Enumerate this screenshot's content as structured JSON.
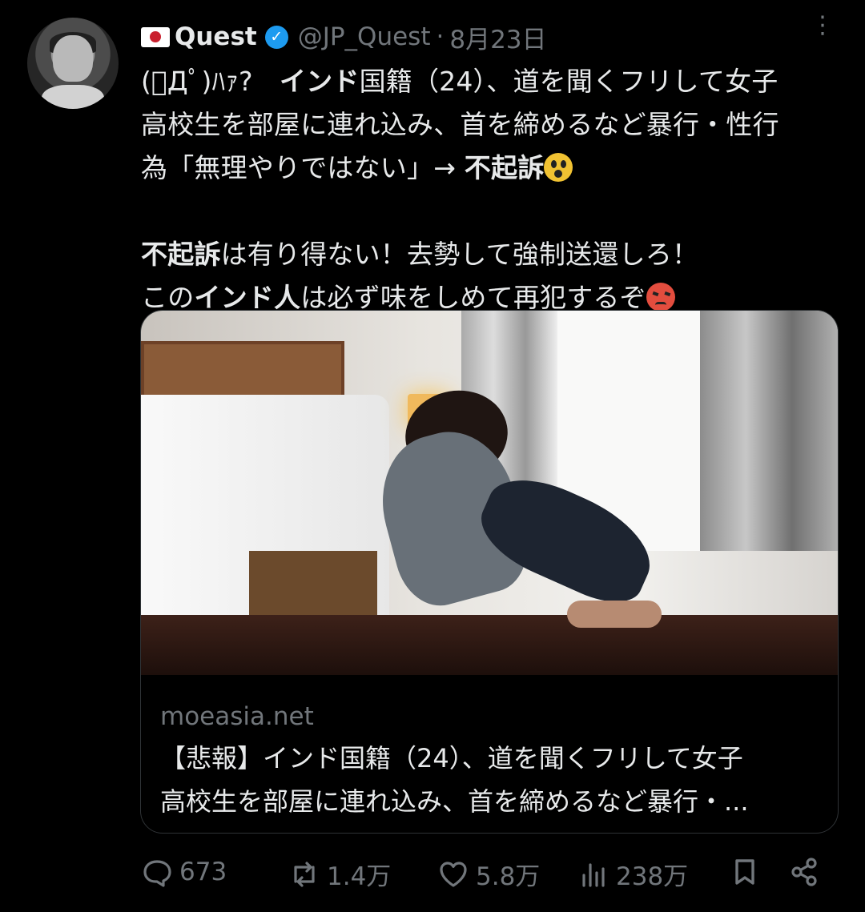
{
  "tweet": {
    "display_name": "Quest",
    "handle": "@JP_Quest",
    "separator": "·",
    "date": "8月23日",
    "more_icon": "three-dots-icon",
    "lines": [
      {
        "parts": [
          "(ﾟДﾟ)ﾊｧ?　",
          "インド",
          "国籍（24）、道を聞くフリして女子"
        ]
      },
      {
        "parts": [
          "高校生を部屋に連れ込み、首を締めるなど暴行・性行"
        ]
      },
      {
        "parts": [
          "為「無理やりではない」→ ",
          "不起訴",
          ""
        ]
      },
      {
        "parts": [
          ""
        ]
      },
      {
        "parts": [
          "不起訴",
          "は有り得ない！去勢して強制送還しろ！"
        ]
      },
      {
        "parts": [
          "この",
          "インド人",
          "は必ず味をしめて再犯するぞ",
          ""
        ]
      }
    ]
  },
  "card": {
    "domain": "moeasia.net",
    "headline_lines": [
      "【悲報】インド国籍（24）、道を聞くフリして女子",
      "高校生を部屋に連れ込み、首を締めるなど暴行・..."
    ]
  },
  "actions": {
    "reply_count": "673",
    "repost_count": "1.4万",
    "like_count": "5.8万",
    "view_count": "238万"
  },
  "colors": {
    "background": "#000000",
    "text": "#e7e9ea",
    "muted": "#71767b",
    "verified": "#1d9bf0"
  }
}
